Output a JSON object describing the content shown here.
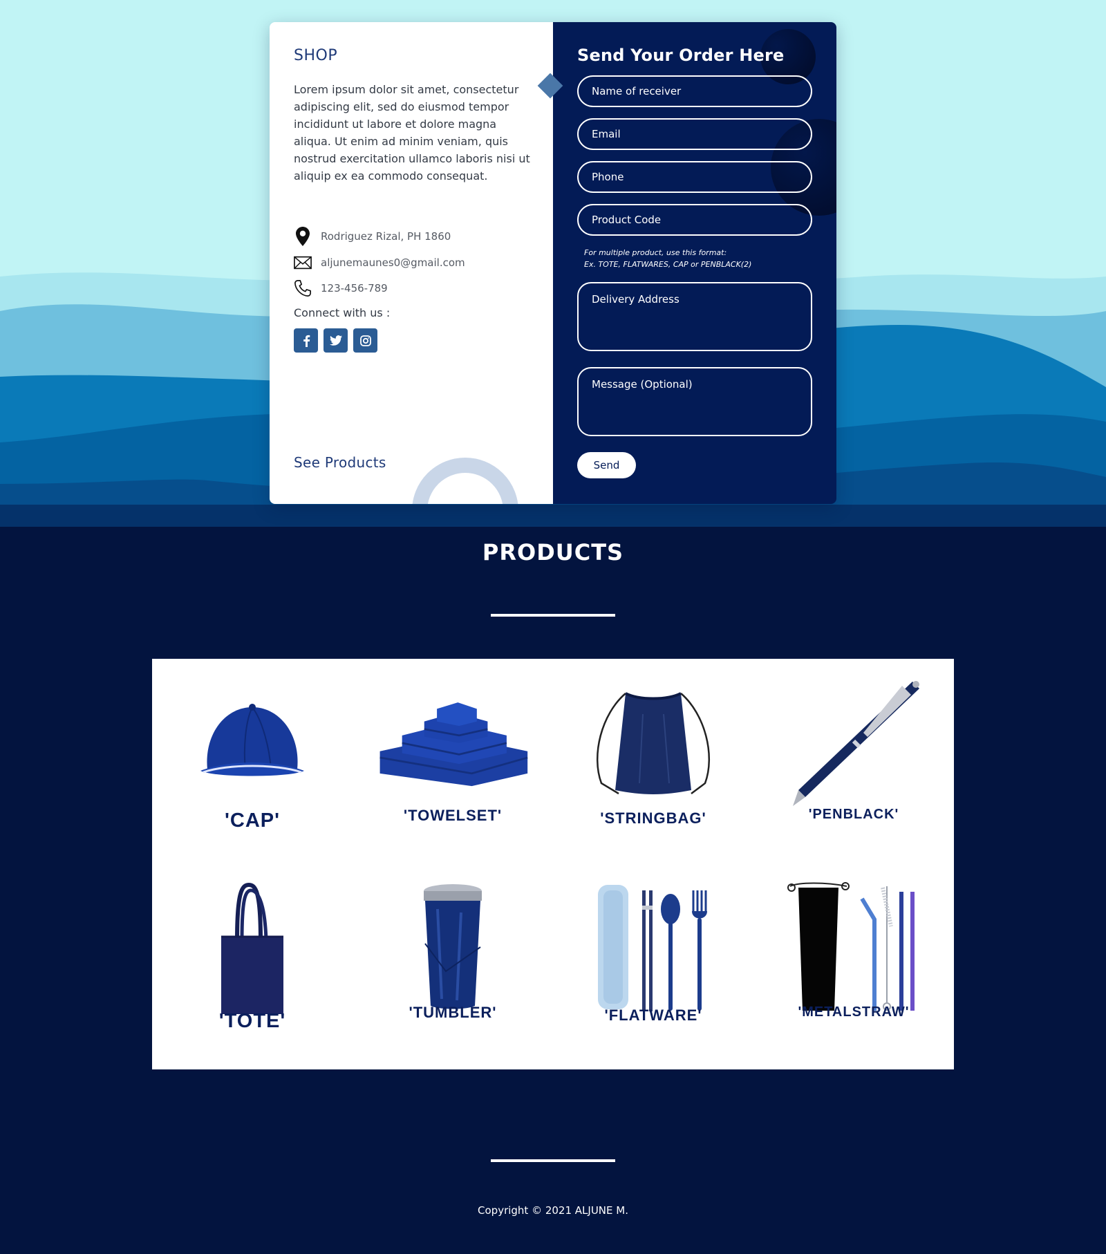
{
  "colors": {
    "hero_sky": "#c1f4f5",
    "navy": "#031b56",
    "page_bg": "#03143f",
    "accent_blue": "#2b5c94"
  },
  "shop": {
    "title": "SHOP",
    "description": "Lorem ipsum dolor sit amet, consectetur adipiscing elit, sed do eiusmod tempor incididunt ut labore et dolore magna aliqua. Ut enim ad minim veniam, quis nostrud exercitation ullamco laboris nisi ut aliquip ex ea commodo consequat.",
    "address": "Rodriguez Rizal, PH 1860",
    "email": "aljunemaunes0@gmail.com",
    "phone": "123-456-789",
    "connect_label": "Connect with us :",
    "socials": [
      "facebook-icon",
      "twitter-icon",
      "instagram-icon"
    ],
    "see_products": "See Products"
  },
  "order_form": {
    "title": "Send Your Order Here",
    "name_placeholder": "Name of receiver",
    "email_placeholder": "Email",
    "phone_placeholder": "Phone",
    "product_code_placeholder": "Product Code",
    "hint_line1": "For multiple product, use this format:",
    "hint_line2": "Ex. TOTE, FLATWARES, CAP or PENBLACK(2)",
    "address_placeholder": "Delivery Address",
    "message_placeholder": "Message (Optional)",
    "send_label": "Send"
  },
  "products": {
    "title": "PRODUCTS",
    "items": [
      {
        "label": "'CAP'"
      },
      {
        "label": "'TOWELSET'"
      },
      {
        "label": "'STRINGBAG'"
      },
      {
        "label": "'PENBLACK'"
      },
      {
        "label": "'TOTE'"
      },
      {
        "label": "'TUMBLER'"
      },
      {
        "label": "'FLATWARE'"
      },
      {
        "label": "'METALSTRAW'"
      }
    ]
  },
  "footer": {
    "copyright": "Copyright © 2021 ALJUNE M."
  }
}
